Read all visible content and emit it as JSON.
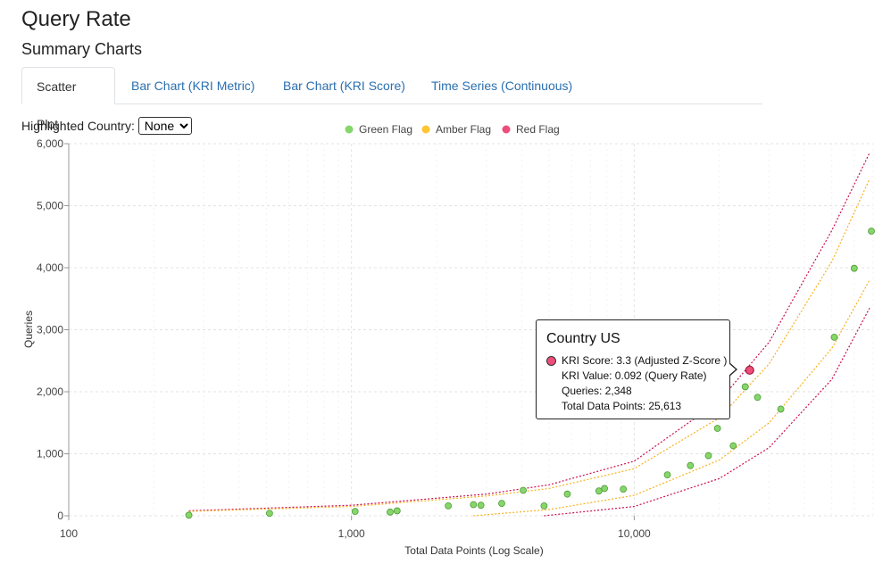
{
  "page": {
    "title": "Query Rate",
    "subtitle": "Summary Charts"
  },
  "tabs": [
    {
      "label": "Scatter Plot",
      "active": true
    },
    {
      "label": "Bar Chart (KRI Metric)",
      "active": false
    },
    {
      "label": "Bar Chart (KRI Score)",
      "active": false
    },
    {
      "label": "Time Series (Continuous)",
      "active": false
    }
  ],
  "filter": {
    "label": "Highlighted Country:",
    "selected": "None"
  },
  "colors": {
    "green": "#86d66a",
    "amber": "#ffc533",
    "red": "#ee4d7a",
    "green_border": "#4e9a3a",
    "red_border": "#9b1b3f",
    "red_line": "#cc0f52",
    "amber_line": "#f7b21e"
  },
  "tooltip": {
    "title": "Country US",
    "lines": [
      "KRI Score: 3.3 (Adjusted Z-Score )",
      "KRI Value: 0.092 (Query Rate)",
      "Queries: 2,348",
      "Total Data Points: 25,613"
    ]
  },
  "chart_data": {
    "type": "scatter",
    "xlabel": "Total Data Points (Log Scale)",
    "ylabel": "Queries",
    "xscale": "log",
    "xlim": [
      100,
      70000
    ],
    "ylim": [
      0,
      6000
    ],
    "xticks": [
      100,
      1000,
      10000
    ],
    "xtick_labels": [
      "100",
      "1,000",
      "10,000"
    ],
    "yticks": [
      0,
      1000,
      2000,
      3000,
      4000,
      5000,
      6000
    ],
    "ytick_labels": [
      "0",
      "1,000",
      "2,000",
      "3,000",
      "4,000",
      "5,000",
      "6,000"
    ],
    "grid": true,
    "legend_position": "top",
    "legend": [
      {
        "label": "Green Flag",
        "color_key": "green"
      },
      {
        "label": "Amber Flag",
        "color_key": "amber"
      },
      {
        "label": "Red Flag",
        "color_key": "red"
      }
    ],
    "series": [
      {
        "name": "Green Flag",
        "points": [
          [
            266,
            10
          ],
          [
            513,
            40
          ],
          [
            1030,
            70
          ],
          [
            1370,
            60
          ],
          [
            1450,
            80
          ],
          [
            2200,
            160
          ],
          [
            2700,
            180
          ],
          [
            2870,
            170
          ],
          [
            3400,
            200
          ],
          [
            4050,
            410
          ],
          [
            4800,
            160
          ],
          [
            5800,
            350
          ],
          [
            7500,
            400
          ],
          [
            7850,
            440
          ],
          [
            9150,
            430
          ],
          [
            13100,
            660
          ],
          [
            15800,
            810
          ],
          [
            18300,
            970
          ],
          [
            19700,
            1410
          ],
          [
            22400,
            1130
          ],
          [
            24700,
            2080
          ],
          [
            27300,
            1910
          ],
          [
            33000,
            1720
          ],
          [
            51000,
            2880
          ],
          [
            60000,
            3990
          ],
          [
            69000,
            4590
          ]
        ]
      },
      {
        "name": "Red Flag",
        "points": [
          [
            25613,
            2348
          ]
        ]
      }
    ],
    "highlighted_point": {
      "country": "US",
      "x": 25613,
      "y": 2348
    },
    "boundary_lines": [
      {
        "flag": "Red",
        "side": "upper",
        "points": [
          [
            266,
            80
          ],
          [
            1000,
            170
          ],
          [
            3000,
            350
          ],
          [
            5000,
            500
          ],
          [
            10000,
            880
          ],
          [
            20000,
            1850
          ],
          [
            30000,
            2800
          ],
          [
            50000,
            4600
          ],
          [
            68000,
            5850
          ]
        ]
      },
      {
        "flag": "Amber",
        "side": "upper",
        "points": [
          [
            266,
            70
          ],
          [
            1000,
            150
          ],
          [
            3000,
            320
          ],
          [
            5000,
            440
          ],
          [
            10000,
            760
          ],
          [
            20000,
            1580
          ],
          [
            30000,
            2450
          ],
          [
            50000,
            4100
          ],
          [
            68000,
            5430
          ]
        ]
      },
      {
        "flag": "Amber",
        "side": "lower",
        "points": [
          [
            2700,
            0
          ],
          [
            5000,
            100
          ],
          [
            10000,
            330
          ],
          [
            20000,
            900
          ],
          [
            30000,
            1500
          ],
          [
            50000,
            2700
          ],
          [
            68000,
            3800
          ]
        ]
      },
      {
        "flag": "Red",
        "side": "lower",
        "points": [
          [
            4800,
            0
          ],
          [
            10000,
            150
          ],
          [
            20000,
            600
          ],
          [
            30000,
            1100
          ],
          [
            50000,
            2200
          ],
          [
            68000,
            3350
          ]
        ]
      }
    ]
  }
}
